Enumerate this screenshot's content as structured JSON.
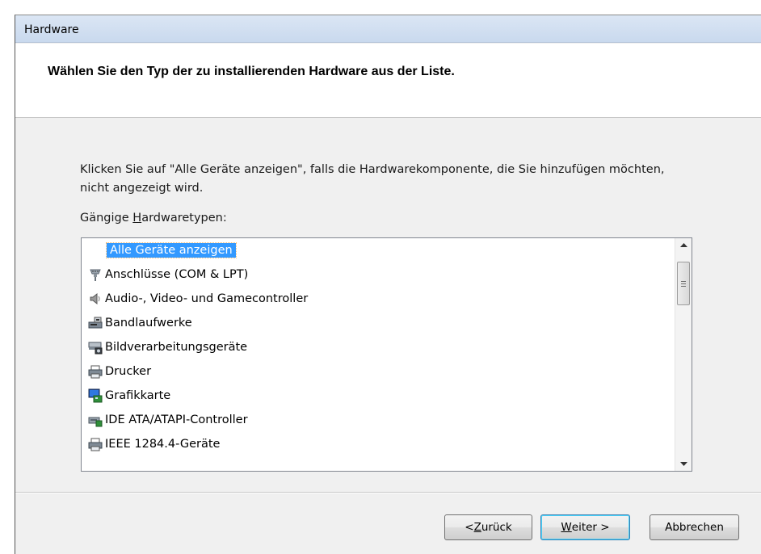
{
  "window": {
    "title": "Hardware"
  },
  "header": {
    "text": "Wählen Sie den Typ der zu installierenden Hardware aus der Liste."
  },
  "instruction": "Klicken Sie auf \"Alle Geräte anzeigen\", falls die Hardwarekomponente, die Sie hinzufügen möchten, nicht angezeigt wird.",
  "list_label": {
    "prefix": "Gängige ",
    "accel": "H",
    "suffix": "ardwaretypen:"
  },
  "list": {
    "items": [
      {
        "label": "Alle Geräte anzeigen",
        "icon": "none",
        "selected": true
      },
      {
        "label": "Anschlüsse (COM & LPT)",
        "icon": "port-connector-icon"
      },
      {
        "label": "Audio-, Video- und Gamecontroller",
        "icon": "speaker-icon"
      },
      {
        "label": "Bandlaufwerke",
        "icon": "tape-drive-icon"
      },
      {
        "label": "Bildverarbeitungsgeräte",
        "icon": "scanner-camera-icon"
      },
      {
        "label": "Drucker",
        "icon": "printer-icon"
      },
      {
        "label": "Grafikkarte",
        "icon": "display-adapter-icon"
      },
      {
        "label": "IDE ATA/ATAPI-Controller",
        "icon": "ide-controller-icon"
      },
      {
        "label": "IEEE 1284.4-Geräte",
        "icon": "printer-icon"
      }
    ]
  },
  "buttons": {
    "back": {
      "accel": "Z",
      "prefix": "< ",
      "suffix": "urück"
    },
    "next": {
      "accel": "W",
      "prefix": "",
      "suffix": "eiter >"
    },
    "cancel": {
      "label": "Abbrechen"
    }
  },
  "colors": {
    "selection": "#3399ff",
    "title_bar": "#d0deef",
    "face": "#f0f0f0"
  }
}
